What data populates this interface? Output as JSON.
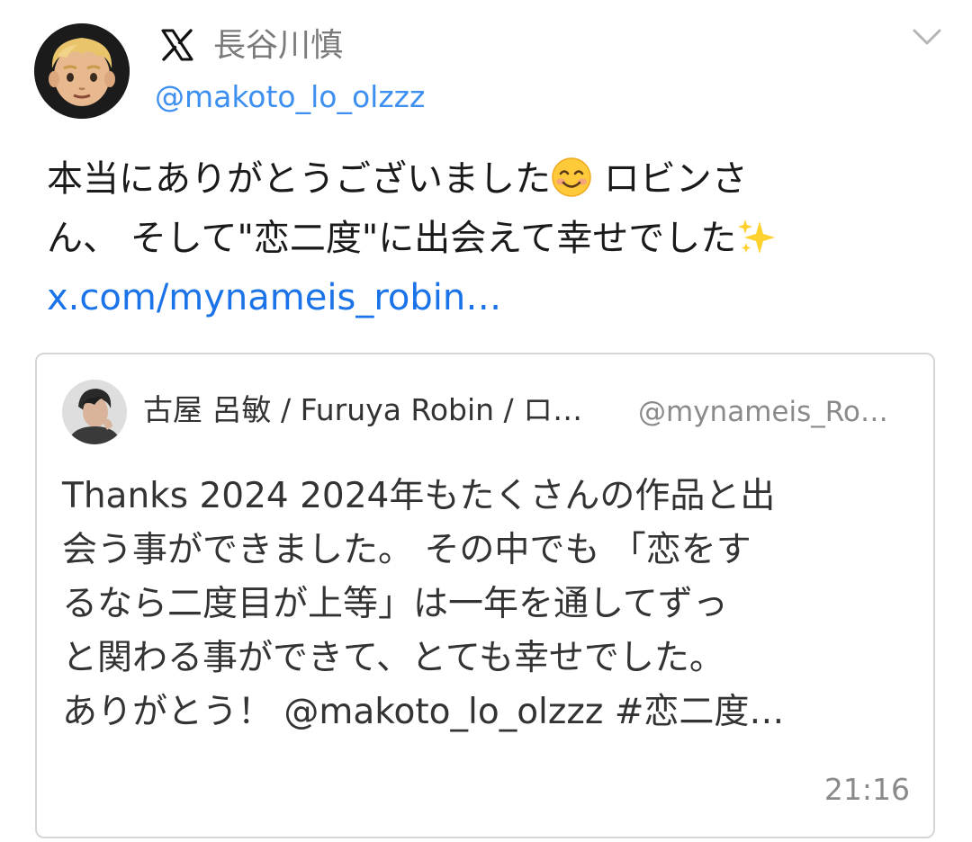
{
  "author": {
    "display_name": "長谷川慎",
    "handle": "@makoto_lo_olzzz",
    "platform_icon": "x-logo-icon",
    "avatar_icon": "blond-person-emoji-icon"
  },
  "menu_icon": "chevron-down-icon",
  "tweet": {
    "lines": [
      "本当にありがとうございました",
      " ロビンさ",
      "ん、 そして\"恋二度\"に出会えて幸せでした"
    ],
    "emoji_1": "smiling-face-icon",
    "emoji_2": "sparkles-icon",
    "link_text": "x.com/mynameis_robin…"
  },
  "quoted_tweet": {
    "display_name": "古屋 呂敏 / Furuya Robin / ロ…",
    "handle": "@mynameis_Ro…",
    "text_lines": [
      "Thanks 2024 2024年もたくさんの作品と出",
      "会う事ができました。 その中でも 「恋をす",
      "るなら二度目が上等」は一年を通してずっ",
      "と関わる事ができて、とても幸せでした。",
      "ありがとう！ @makoto_lo_olzzz #恋二度…"
    ],
    "time": "21:16"
  },
  "colors": {
    "link": "#1a73e8",
    "handle": "#3d8ff0",
    "muted": "#8a8a8a",
    "border": "#d6d6d6"
  }
}
